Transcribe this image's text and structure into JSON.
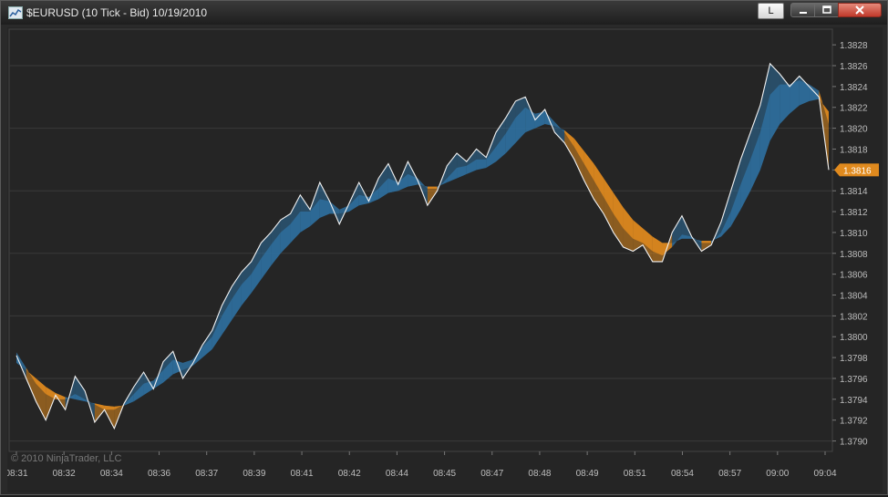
{
  "window": {
    "title": "$EURUSD (10 Tick - Bid)  10/19/2010",
    "link_button_label": "L"
  },
  "chart": {
    "copyright": "© 2010 NinjaTrader, LLC",
    "last_price_label": "1.3816",
    "colors": {
      "background": "#252525",
      "price_line": "#f2f2f2",
      "ribbon_bull": "#2e6f9e",
      "ribbon_bear": "#e08a1e",
      "grid": "#3a3a3a",
      "axis_text": "#bdbdbd"
    }
  },
  "chart_data": {
    "type": "line",
    "title": "",
    "xlabel": "",
    "ylabel": "",
    "ylim": [
      1.3789,
      1.38295
    ],
    "y_ticks": [
      "1.3790",
      "1.3792",
      "1.3794",
      "1.3796",
      "1.3798",
      "1.3800",
      "1.3802",
      "1.3804",
      "1.3806",
      "1.3808",
      "1.3810",
      "1.3812",
      "1.3814",
      "1.3816",
      "1.3818",
      "1.3820",
      "1.3822",
      "1.3824",
      "1.3826",
      "1.3828"
    ],
    "x_ticks": [
      "08:31",
      "08:32",
      "08:34",
      "08:36",
      "08:37",
      "08:39",
      "08:41",
      "08:42",
      "08:44",
      "08:45",
      "08:47",
      "08:48",
      "08:49",
      "08:51",
      "08:54",
      "08:57",
      "09:00",
      "09:04"
    ],
    "series": [
      {
        "name": "",
        "values": [
          1.37982,
          1.3796,
          1.37938,
          1.3792,
          1.37944,
          1.3793,
          1.37962,
          1.37948,
          1.37918,
          1.3793,
          1.37912,
          1.37936,
          1.37952,
          1.37966,
          1.3795,
          1.37976,
          1.37986,
          1.3796,
          1.37974,
          1.37992,
          1.38006,
          1.3803,
          1.38048,
          1.38062,
          1.38072,
          1.3809,
          1.381,
          1.38112,
          1.38118,
          1.38136,
          1.38122,
          1.38148,
          1.3813,
          1.38108,
          1.38128,
          1.38148,
          1.3813,
          1.38152,
          1.38166,
          1.38146,
          1.38168,
          1.3815,
          1.38126,
          1.3814,
          1.38164,
          1.38176,
          1.38168,
          1.3818,
          1.38172,
          1.38196,
          1.3821,
          1.38226,
          1.3823,
          1.38208,
          1.38218,
          1.38196,
          1.38186,
          1.3817,
          1.3815,
          1.38132,
          1.38118,
          1.381,
          1.38086,
          1.38082,
          1.38088,
          1.38072,
          1.38072,
          1.381,
          1.38116,
          1.38096,
          1.38082,
          1.38088,
          1.3811,
          1.3814,
          1.3817,
          1.38196,
          1.38222,
          1.38262,
          1.38252,
          1.3824,
          1.3825,
          1.3824,
          1.3823,
          1.3816
        ],
        "ribbon_fast": [
          1.37985,
          1.3797,
          1.37955,
          1.37945,
          1.3794,
          1.3794,
          1.37945,
          1.3794,
          1.37935,
          1.3793,
          1.3793,
          1.37935,
          1.37945,
          1.37955,
          1.37958,
          1.37968,
          1.37978,
          1.37975,
          1.37978,
          1.3799,
          1.38,
          1.3802,
          1.38036,
          1.3805,
          1.3806,
          1.38075,
          1.38088,
          1.381,
          1.38108,
          1.3812,
          1.3812,
          1.38132,
          1.3813,
          1.38122,
          1.38126,
          1.38136,
          1.38134,
          1.38142,
          1.38152,
          1.38148,
          1.38156,
          1.38152,
          1.38142,
          1.38142,
          1.38152,
          1.38162,
          1.38164,
          1.3817,
          1.3817,
          1.38182,
          1.38195,
          1.3821,
          1.3822,
          1.38214,
          1.38216,
          1.38206,
          1.38196,
          1.38182,
          1.38166,
          1.3815,
          1.38134,
          1.38118,
          1.38104,
          1.38094,
          1.3809,
          1.38082,
          1.38078,
          1.38086,
          1.38098,
          1.38096,
          1.3809,
          1.3809,
          1.381,
          1.3812,
          1.38146,
          1.3817,
          1.38196,
          1.38232,
          1.38242,
          1.38242,
          1.38246,
          1.38242,
          1.38236,
          1.38204
        ],
        "ribbon_slow": [
          1.37975,
          1.37968,
          1.3796,
          1.37952,
          1.37946,
          1.37942,
          1.3794,
          1.37938,
          1.37936,
          1.37934,
          1.37933,
          1.37934,
          1.37938,
          1.37944,
          1.3795,
          1.37956,
          1.37964,
          1.37968,
          1.37972,
          1.3798,
          1.37988,
          1.38002,
          1.38016,
          1.3803,
          1.38042,
          1.38055,
          1.38068,
          1.3808,
          1.3809,
          1.381,
          1.38106,
          1.38114,
          1.38118,
          1.38118,
          1.3812,
          1.38126,
          1.38128,
          1.38132,
          1.38138,
          1.3814,
          1.38144,
          1.38146,
          1.38144,
          1.38144,
          1.38148,
          1.38152,
          1.38156,
          1.3816,
          1.38162,
          1.38168,
          1.38176,
          1.38186,
          1.38196,
          1.382,
          1.38204,
          1.38202,
          1.38198,
          1.3819,
          1.38178,
          1.38166,
          1.38152,
          1.38138,
          1.38124,
          1.38112,
          1.38104,
          1.38096,
          1.3809,
          1.3809,
          1.38094,
          1.38094,
          1.38092,
          1.38092,
          1.38096,
          1.38106,
          1.38122,
          1.3814,
          1.3816,
          1.38188,
          1.38204,
          1.38214,
          1.38222,
          1.38226,
          1.38228,
          1.38216
        ]
      }
    ],
    "grid": true,
    "last_price": 1.3816
  }
}
